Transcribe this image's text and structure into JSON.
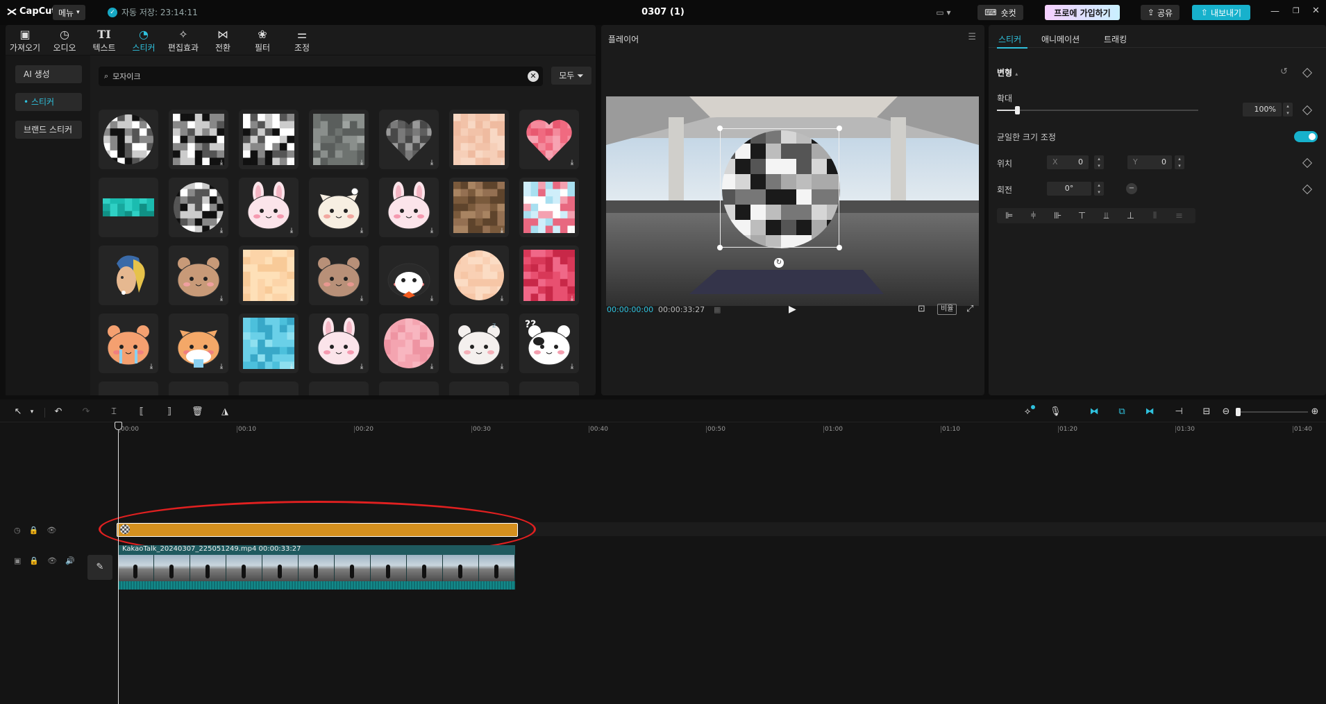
{
  "topbar": {
    "logo": "CapCut",
    "menu_label": "메뉴",
    "autosave_label": "자동 저장: 23:14:11",
    "project_title": "0307 (1)",
    "shortcut_label": "숏컷",
    "pro_label": "프로에 가입하기",
    "share_label": "공유",
    "export_label": "내보내기"
  },
  "toolbar": {
    "tabs": [
      {
        "label": "가져오기",
        "icon": "import-icon"
      },
      {
        "label": "오디오",
        "icon": "audio-icon"
      },
      {
        "label": "텍스트",
        "icon": "text-icon"
      },
      {
        "label": "스티커",
        "icon": "sticker-icon",
        "active": true
      },
      {
        "label": "편집효과",
        "icon": "effects-icon"
      },
      {
        "label": "전환",
        "icon": "transition-icon"
      },
      {
        "label": "필터",
        "icon": "filter-icon"
      },
      {
        "label": "조정",
        "icon": "adjust-icon"
      }
    ]
  },
  "sidebar": {
    "items": [
      {
        "label": "AI 생성"
      },
      {
        "label": "스티커",
        "active": true
      },
      {
        "label": "브랜드 스티커"
      }
    ]
  },
  "search": {
    "value": "모자이크",
    "filter_label": "모두"
  },
  "stickers": {
    "rows": [
      [
        "mosaic-circle-bw",
        "mosaic-square-bw",
        "mosaic-square-bw2",
        "mosaic-square-gray",
        "mosaic-heart-gray",
        "mosaic-square-skin",
        "mosaic-heart-pink"
      ],
      [
        "mosaic-bar-teal",
        "mosaic-circle-bw2",
        "bunny-face",
        "cat-face",
        "bunny-face-2",
        "mosaic-square-brown",
        "mosaic-square-pastel"
      ],
      [
        "pearl-earring-girl",
        "bear-face",
        "mosaic-square-peach",
        "fluffy-bear",
        "penguin",
        "mosaic-circle-peach",
        "mosaic-square-red"
      ],
      [
        "tiger-crying",
        "shiba-crying",
        "mosaic-square-cyan",
        "bunny-face-3",
        "mosaic-circle-pink",
        "sheep-sleeping",
        "cow-confused"
      ]
    ]
  },
  "player": {
    "title": "플레이어",
    "current_time": "00:00:00:00",
    "total_time": "00:00:33:27",
    "ratio_label": "비율"
  },
  "properties": {
    "tabs": [
      "스티커",
      "애니메이션",
      "트래킹"
    ],
    "section_title": "변형",
    "scale_label": "확대",
    "scale_value": "100%",
    "scale_level": 0.1,
    "uniform_label": "균일한 크기 조정",
    "uniform_on": true,
    "position_label": "위치",
    "x_label": "X",
    "x_value": "0",
    "y_label": "Y",
    "y_value": "0",
    "rotation_label": "회전",
    "rotation_value": "0°"
  },
  "timeline": {
    "ticks": [
      "00:00",
      "00:10",
      "00:20",
      "00:30",
      "00:40",
      "00:50",
      "01:00",
      "01:10",
      "01:20",
      "01:30",
      "01:40"
    ],
    "video_clip_label": "KakaoTalk_20240307_225051249.mp4  00:00:33:27",
    "sticker_clip_color": "#d4901f",
    "highlight_color": "#e02020"
  },
  "colors": {
    "accent": "#2fc1dd",
    "panel": "#1b1b1b"
  }
}
